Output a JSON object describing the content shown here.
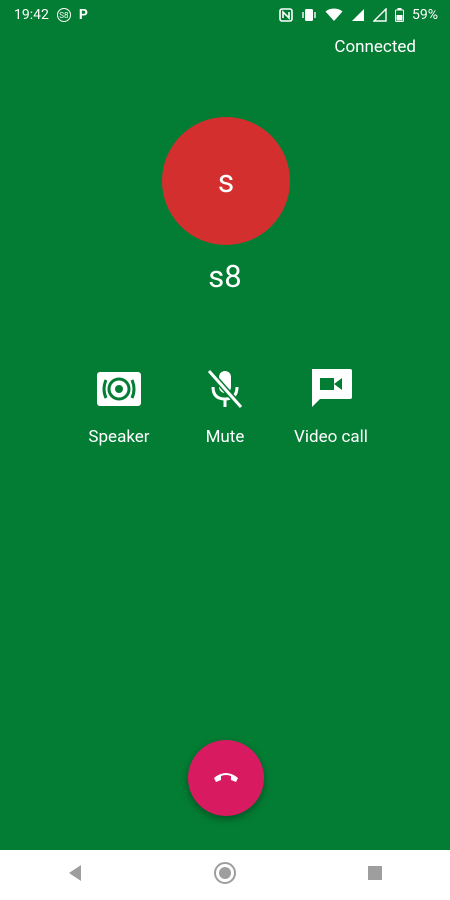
{
  "status_bar": {
    "time": "19:42",
    "badge_text": "S8",
    "p_icon_label": "P",
    "battery": "59%",
    "icons": [
      "nfc-icon",
      "vibrate-icon",
      "wifi-icon",
      "signal-icon",
      "signal-icon-2",
      "battery-icon"
    ]
  },
  "call": {
    "status": "Connected",
    "avatar_letter": "s",
    "caller_name": "s8"
  },
  "actions": [
    {
      "label": "Speaker",
      "icon": "speaker-icon"
    },
    {
      "label": "Mute",
      "icon": "mute-mic-icon"
    },
    {
      "label": "Video call",
      "icon": "video-call-icon"
    }
  ],
  "end_call": {
    "icon": "end-call-icon"
  },
  "navbar": {
    "buttons": [
      "back-icon",
      "home-icon",
      "recents-icon"
    ]
  },
  "colors": {
    "background": "#047d34",
    "avatar": "#d32f2f",
    "end_call": "#d81b60",
    "navbar": "#ffffff"
  }
}
